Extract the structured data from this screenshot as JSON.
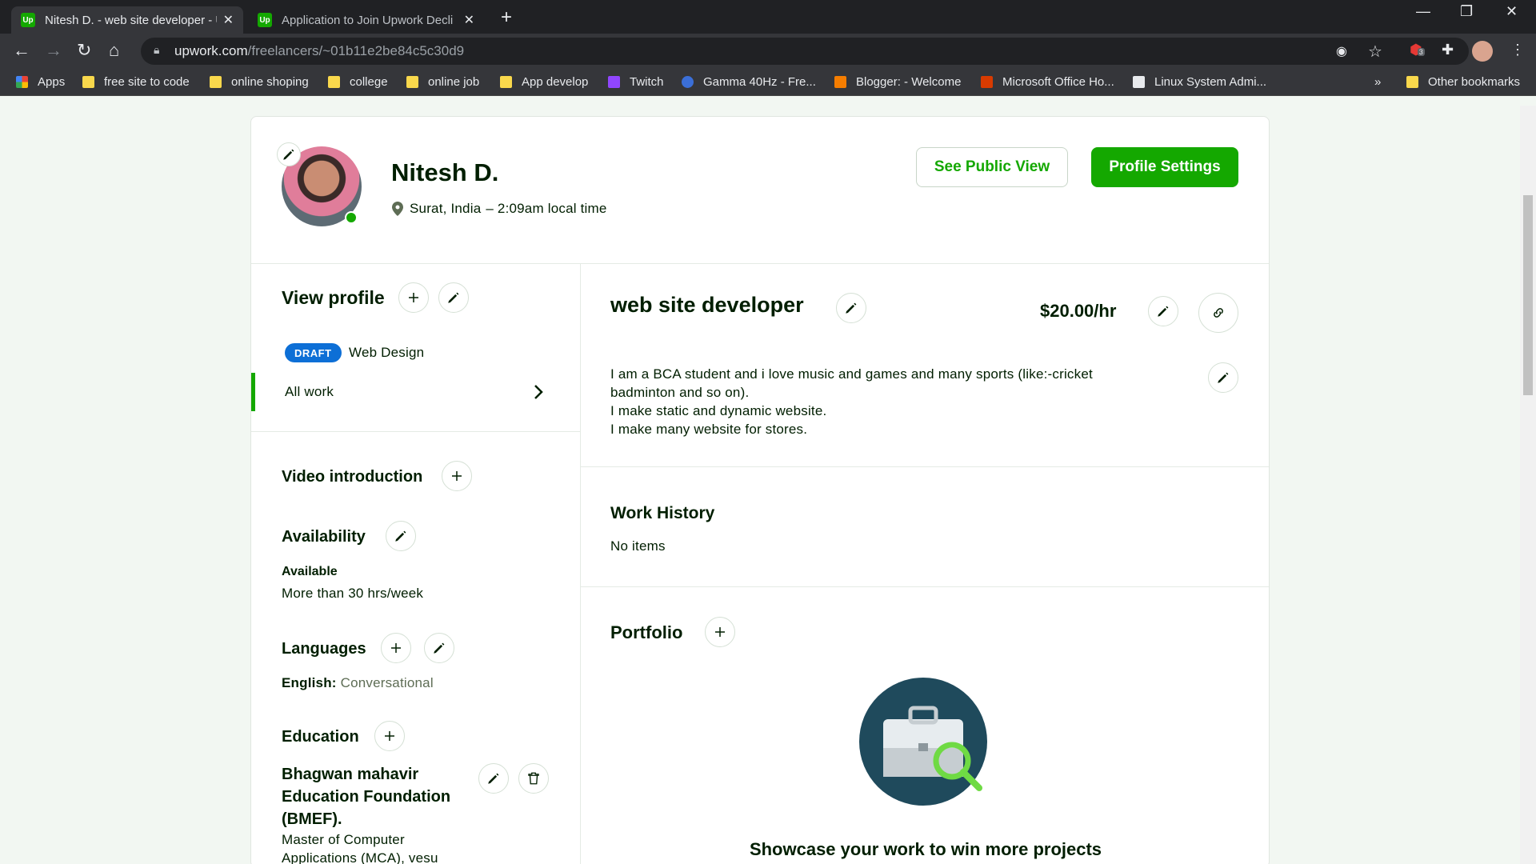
{
  "browser": {
    "tabs": [
      {
        "title": "Nitesh D. - web site developer - U"
      },
      {
        "title": "Application to Join Upwork Decli"
      }
    ],
    "url_domain": "upwork.com",
    "url_path": "/freelancers/~01b11e2be84c5c30d9",
    "extension_badge": "3",
    "bookmarks": [
      "Apps",
      "free site to code",
      "online shoping",
      "college",
      "online job",
      "App develop",
      "Twitch",
      "Gamma 40Hz - Fre...",
      "Blogger: - Welcome",
      "Microsoft Office Ho...",
      "Linux System Admi..."
    ],
    "overflow": "»",
    "other_bookmarks": "Other bookmarks"
  },
  "profile": {
    "name": "Nitesh D.",
    "location": "Surat, India",
    "local_time": "– 2:09am local time",
    "see_public_view": "See Public View",
    "profile_settings": "Profile Settings"
  },
  "sidebar": {
    "view_profile": "View profile",
    "draft_badge": "DRAFT",
    "draft_category": "Web Design",
    "all_work": "All work",
    "video_intro": "Video introduction",
    "availability_title": "Availability",
    "availability_status": "Available",
    "availability_hours": "More than 30 hrs/week",
    "languages_title": "Languages",
    "language_name": "English:",
    "language_level": "Conversational",
    "education_title": "Education",
    "school": "Bhagwan mahavir Education Foundation (BMEF).",
    "degree": "Master of Computer Applications (MCA), vesu"
  },
  "main": {
    "title": "web site developer",
    "rate": "$20.00/hr",
    "description": [
      "I am a BCA student and i love music and games and many sports (like:-cricket",
      "badminton and so on).",
      "I make static and dynamic website.",
      "I make many website for stores."
    ],
    "work_history_title": "Work History",
    "work_history_empty": "No items",
    "portfolio_title": "Portfolio",
    "portfolio_cta": "Showcase your work to win more projects"
  },
  "colors": {
    "brand_green": "#14a800",
    "draft_blue": "#0d6fd6",
    "dark_teal": "#1f4a5c"
  }
}
